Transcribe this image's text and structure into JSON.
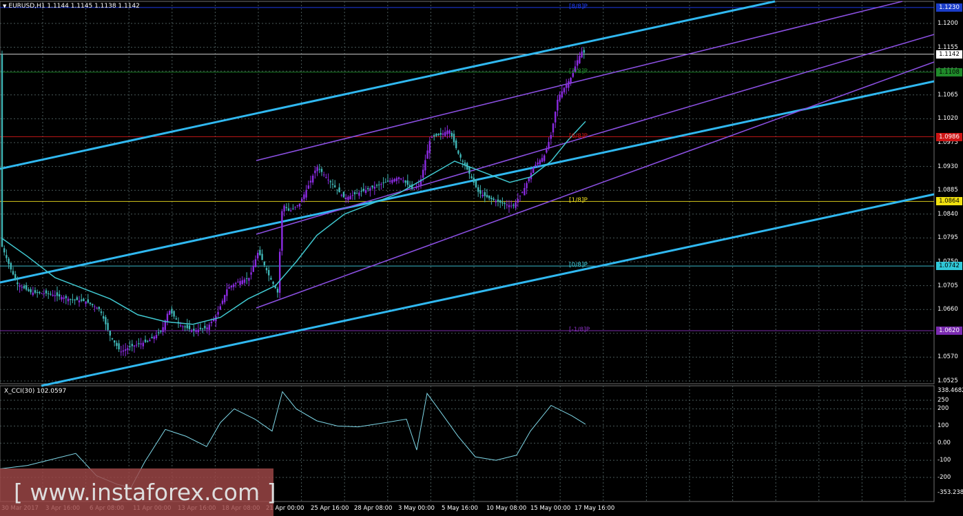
{
  "header": {
    "symbol_line": "EURUSD,H1  1.1144 1.1145 1.1138 1.1142"
  },
  "cci": {
    "label": "X_CCI(30) 102.0597"
  },
  "watermark": "[ www.instaforex.com ]",
  "colors": {
    "background": "#000000",
    "grid": "#4a5a5a",
    "bull_candle": "#8b2be2",
    "bear_candle": "#3fb6b6",
    "ma": "#40c8d0",
    "regression": "#8a4fe0",
    "trendline": "#30b8f0",
    "cci_line": "#7fd8e8"
  },
  "price_axis": [
    "1.1200",
    "1.1155",
    "1.1110",
    "1.1065",
    "1.1020",
    "1.0975",
    "1.0930",
    "1.0885",
    "1.0840",
    "1.0795",
    "1.0750",
    "1.0705",
    "1.0660",
    "1.0615",
    "1.0570",
    "1.0525"
  ],
  "price_labels": [
    {
      "name": "murray-8-8",
      "text": "1.1230",
      "bg": "#1a3cc8",
      "fg": "#ffffff",
      "price": 1.123
    },
    {
      "name": "current-price",
      "text": "1.1142",
      "bg": "#ffffff",
      "fg": "#000000",
      "price": 1.1142
    },
    {
      "name": "murray-7-8",
      "text": "1.1108",
      "bg": "#1f8a2a",
      "fg": "#000000",
      "price": 1.1108
    },
    {
      "name": "murray-6-8",
      "text": "1.0986",
      "bg": "#cc1414",
      "fg": "#ffffff",
      "price": 1.0986
    },
    {
      "name": "murray-1-8",
      "text": "1.0864",
      "bg": "#f0e010",
      "fg": "#000000",
      "price": 1.0864
    },
    {
      "name": "murray-0-8",
      "text": "1.0742",
      "bg": "#30c8d8",
      "fg": "#000000",
      "price": 1.0742
    },
    {
      "name": "murray-minus-1-8",
      "text": "1.0620",
      "bg": "#7a2ab0",
      "fg": "#ffffff",
      "price": 1.062
    }
  ],
  "murray_levels": [
    {
      "label": "[8/8]P",
      "color": "#2040ff",
      "price": 1.123
    },
    {
      "label": "[7/8]P",
      "color": "#1f8a2a",
      "price": 1.1108
    },
    {
      "label": "[6/8]P",
      "color": "#d01818",
      "price": 1.0986
    },
    {
      "label": "[1/8]P",
      "color": "#f0e020",
      "price": 1.0864
    },
    {
      "label": "[0/8]P",
      "color": "#40d0e0",
      "price": 1.0742
    },
    {
      "label": "[-1/8]P",
      "color": "#8a30c0",
      "price": 1.062
    }
  ],
  "cci_axis": [
    "338.4682",
    "250",
    "200",
    "100",
    "0.00",
    "-100",
    "-200",
    "-353.2381"
  ],
  "time_axis": [
    "30 Mar 2017",
    "3 Apr 16:00",
    "6 Apr 08:00",
    "11 Apr 00:00",
    "13 Apr 16:00",
    "18 Apr 08:00",
    "21 Apr 00:00",
    "25 Apr 16:00",
    "28 Apr 08:00",
    "3 May 00:00",
    "5 May 16:00",
    "10 May 08:00",
    "15 May 00:00",
    "17 May 16:00"
  ]
}
